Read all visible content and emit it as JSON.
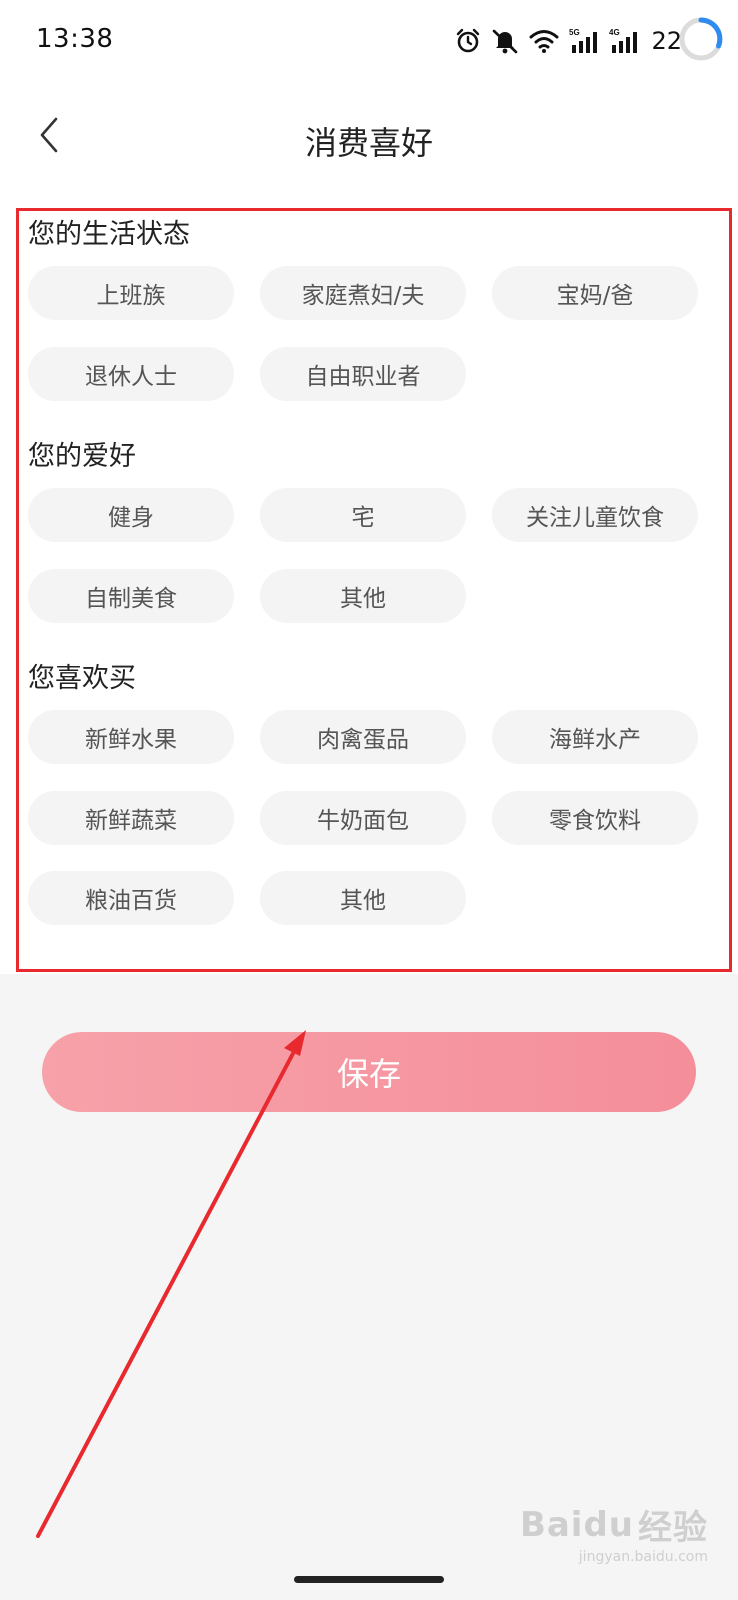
{
  "status_bar": {
    "time": "13:38",
    "battery": "22",
    "network_5g": "5G",
    "network_4g": "4G",
    "icons": [
      "alarm-icon",
      "mute-icon",
      "wifi-icon",
      "signal-5g-icon",
      "signal-4g-icon",
      "loading-ring-icon"
    ]
  },
  "header": {
    "title": "消费喜好",
    "back_icon": "chevron-left-icon"
  },
  "sections": [
    {
      "title": "您的生活状态",
      "options": [
        "上班族",
        "家庭煮妇/夫",
        "宝妈/爸",
        "退休人士",
        "自由职业者"
      ]
    },
    {
      "title": "您的爱好",
      "options": [
        "健身",
        "宅",
        "关注儿童饮食",
        "自制美食",
        "其他"
      ]
    },
    {
      "title": "您喜欢买",
      "options": [
        "新鲜水果",
        "肉禽蛋品",
        "海鲜水产",
        "新鲜蔬菜",
        "牛奶面包",
        "零食饮料",
        "粮油百货",
        "其他"
      ]
    }
  ],
  "save_button": {
    "label": "保存"
  },
  "watermark": {
    "brand": "Baidu",
    "brand_cn": "经验",
    "url": "jingyan.baidu.com"
  },
  "colors": {
    "accent": "#f48e9a",
    "annotation": "#e8292e",
    "chip_bg": "#f4f4f4"
  }
}
